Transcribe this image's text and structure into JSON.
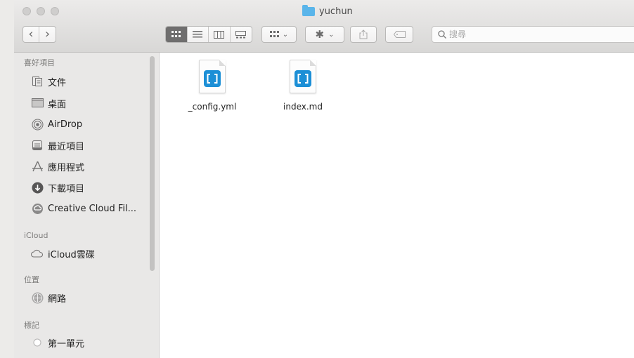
{
  "window": {
    "title": "yuchun"
  },
  "toolbar": {
    "back_label": "‹",
    "forward_label": "›",
    "view_modes": [
      "icon-view",
      "list-view",
      "column-view",
      "gallery-view"
    ],
    "arrange_arrow": "⌄",
    "action_arrow": "⌄",
    "search": {
      "placeholder": "搜尋",
      "value": ""
    }
  },
  "sidebar": {
    "favorites_title": "喜好項目",
    "favorites": [
      {
        "label": "文件",
        "icon": "documents-icon"
      },
      {
        "label": "桌面",
        "icon": "desktop-icon"
      },
      {
        "label": "AirDrop",
        "icon": "airdrop-icon"
      },
      {
        "label": "最近項目",
        "icon": "recents-icon"
      },
      {
        "label": "應用程式",
        "icon": "applications-icon"
      },
      {
        "label": "下載項目",
        "icon": "downloads-icon"
      },
      {
        "label": "Creative Cloud Fil...",
        "icon": "creative-cloud-icon"
      }
    ],
    "icloud_title": "iCloud",
    "icloud": [
      {
        "label": "iCloud雲碟",
        "icon": "icloud-icon"
      }
    ],
    "locations_title": "位置",
    "locations": [
      {
        "label": "網路",
        "icon": "network-icon"
      }
    ],
    "tags_title": "標記",
    "tags": [
      {
        "label": "第一單元",
        "icon": "tag-circle-icon"
      }
    ]
  },
  "files": [
    {
      "name": "_config.yml",
      "icon": "brackets-file-icon"
    },
    {
      "name": "index.md",
      "icon": "brackets-file-icon"
    }
  ],
  "colors": {
    "folder_accent": "#5ab5ea",
    "file_badge": "#1c8fd6",
    "active_view": "#6f6e6e"
  }
}
